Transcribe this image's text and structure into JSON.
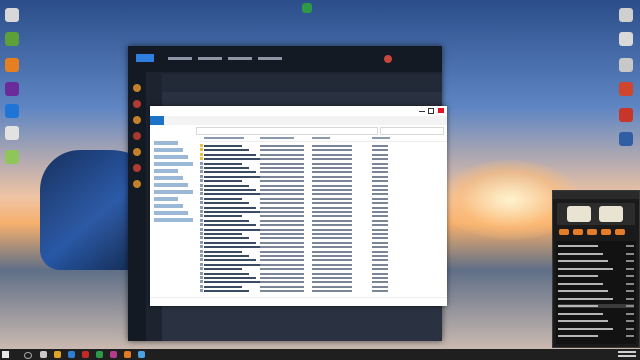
{
  "colors": {
    "taskbar": "#1f1f1f",
    "explorer_accent": "#1a73c6",
    "game_bg": "#1d2430",
    "player_accent": "#e47d2a"
  },
  "desktop": {
    "left_icons": [
      "orange",
      "green",
      "blue",
      "yellow",
      "pink",
      "lightgreen",
      "red"
    ],
    "right_icons": [
      "gray",
      "red",
      "red",
      "blue",
      "red",
      "orange"
    ],
    "top_center_icon": "green-arrow-icon"
  },
  "explorer": {
    "nav_items": 12,
    "rows": 34
  },
  "player": {
    "rows": 13
  },
  "taskbar": {
    "icons": [
      "folder-icon",
      "gear-icon",
      "browser-icon",
      "game-icon",
      "music-icon",
      "app-icon",
      "store-icon",
      "mail-icon"
    ]
  }
}
